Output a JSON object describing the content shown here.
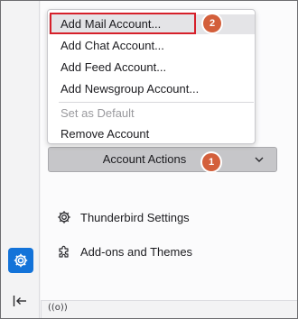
{
  "menu": {
    "items": [
      {
        "label": "Add Mail Account..."
      },
      {
        "label": "Add Chat Account..."
      },
      {
        "label": "Add Feed Account..."
      },
      {
        "label": "Add Newsgroup Account..."
      },
      {
        "label": "Set as Default"
      },
      {
        "label": "Remove Account"
      }
    ]
  },
  "account_actions": {
    "label": "Account Actions"
  },
  "annotations": {
    "step1": "1",
    "step2": "2"
  },
  "links": {
    "settings": "Thunderbird Settings",
    "addons": "Add-ons and Themes"
  },
  "statusbar": {
    "icon": "((o))"
  },
  "colors": {
    "accent": "#1373d9",
    "badge": "#d35f3b",
    "highlight_border": "#d6202a"
  },
  "icons": {
    "spaces_settings": "gear-icon",
    "collapse": "collapse-left-icon",
    "chevron": "chevron-down-icon",
    "settings": "gear-icon",
    "addons": "puzzle-icon",
    "status": "radio-signal-icon"
  }
}
